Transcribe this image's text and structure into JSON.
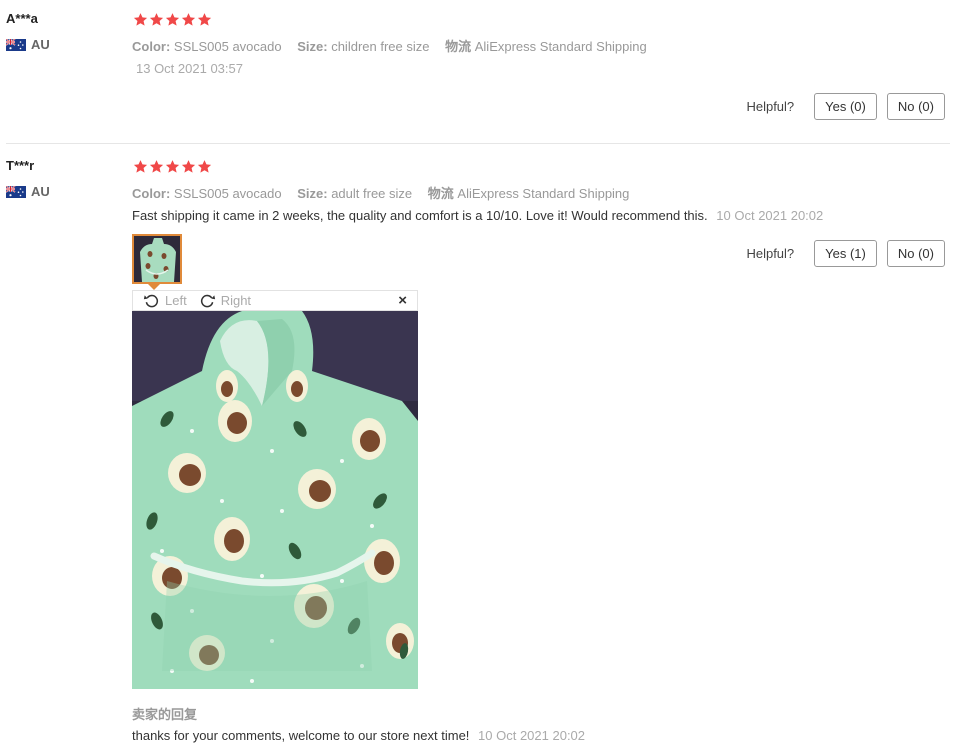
{
  "reviews": [
    {
      "user": "A***a",
      "country": "AU",
      "rating": 5,
      "attrs": [
        {
          "key": "Color:",
          "value": "SSLS005 avocado"
        },
        {
          "key": "Size:",
          "value": "children free size"
        },
        {
          "key": "物流",
          "value": "AliExpress Standard Shipping"
        }
      ],
      "date": "13 Oct 2021 03:57",
      "helpful_label": "Helpful?",
      "yes_label": "Yes (0)",
      "no_label": "No (0)"
    },
    {
      "user": "T***r",
      "country": "AU",
      "rating": 5,
      "attrs": [
        {
          "key": "Color:",
          "value": "SSLS005 avocado"
        },
        {
          "key": "Size:",
          "value": "adult free size"
        },
        {
          "key": "物流",
          "value": "AliExpress Standard Shipping"
        }
      ],
      "content": "Fast shipping it came in 2 weeks, the quality and comfort is a 10/10. Love it! Would recommend this.",
      "date": "10 Oct 2021 20:02",
      "helpful_label": "Helpful?",
      "yes_label": "Yes (1)",
      "no_label": "No (0)",
      "viewer": {
        "rotate_left": "Left",
        "rotate_right": "Right",
        "close": "×"
      },
      "seller_reply": {
        "title": "卖家的回复",
        "text": "thanks for your comments, welcome to our store next time!",
        "date": "10 Oct 2021 20:02"
      }
    }
  ],
  "colors": {
    "star": "#f04848",
    "thumb_border": "#e08a3a",
    "hoodie": "#9fdcbc",
    "avocado_pit": "#7a4a2e"
  }
}
